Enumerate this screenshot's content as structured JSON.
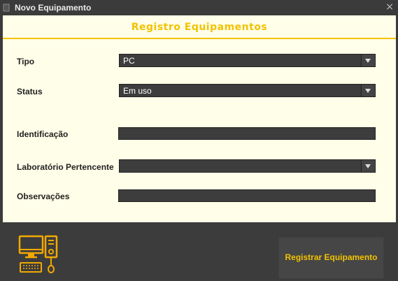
{
  "window": {
    "title": "Novo Equipamento",
    "close_symbol": "×"
  },
  "header": {
    "title": "Registro Equipamentos"
  },
  "form": {
    "tipo": {
      "label": "Tipo",
      "value": "PC"
    },
    "status": {
      "label": "Status",
      "value": "Em uso"
    },
    "identificacao": {
      "label": "Identificação",
      "value": ""
    },
    "laboratorio": {
      "label": "Laboratório Pertencente",
      "value": ""
    },
    "observacoes": {
      "label": "Observações",
      "value": ""
    }
  },
  "footer": {
    "register_label": "Registrar Equipamento",
    "logo_icon": "computer-equipment-icon"
  },
  "colors": {
    "accent": "#f2c200",
    "panel": "#fffee8",
    "dark": "#3c3c3c"
  }
}
